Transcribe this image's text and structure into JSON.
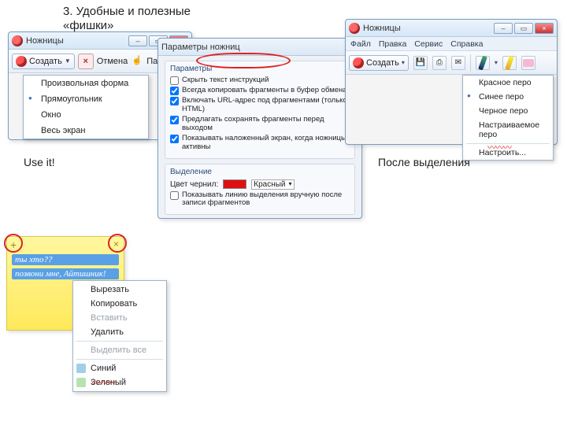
{
  "slide": {
    "title": "3. Удобные и полезные «фишки»",
    "use_it": "Use it!",
    "after_selection": "После выделения"
  },
  "win1": {
    "title": "Ножницы",
    "create": "Создать",
    "cancel": "Отмена",
    "menu": {
      "freeform": "Произвольная форма",
      "rect": "Прямоугольник",
      "window": "Окно",
      "fullscreen": "Весь экран"
    }
  },
  "win2": {
    "title": "Параметры ножниц",
    "group_app": "Параметры",
    "hide_instr": "Скрыть текст инструкций",
    "always_copy": "Всегда копировать фрагменты в буфер обмена",
    "include_url": "Включать URL-адрес под фрагментами (только HTML)",
    "prompt_save": "Предлагать сохранять фрагменты перед выходом",
    "show_overlay": "Показывать наложенный экран, когда ножницы активны",
    "group_sel": "Выделение",
    "ink_color_label": "Цвет чернил:",
    "ink_color": "Красный",
    "show_sel_line": "Показывать линию выделения вручную после записи фрагментов"
  },
  "win3": {
    "title": "Ножницы",
    "menubar": {
      "file": "Файл",
      "edit": "Правка",
      "tools": "Сервис",
      "help": "Справка"
    },
    "create": "Создать",
    "pen_menu": {
      "red": "Красное перо",
      "blue": "Синее перо",
      "black": "Черное перо",
      "custom": "Настраиваемое перо",
      "configure": "Настроить..."
    }
  },
  "sticky": {
    "line1": "ты хто??",
    "line2": "позвони мне, Айтишник!",
    "ctx": {
      "cut": "Вырезать",
      "copy": "Копировать",
      "paste": "Вставить",
      "delete": "Удалить",
      "select_all": "Выделить все",
      "blue": "Синий",
      "green": "Зеленый"
    }
  }
}
